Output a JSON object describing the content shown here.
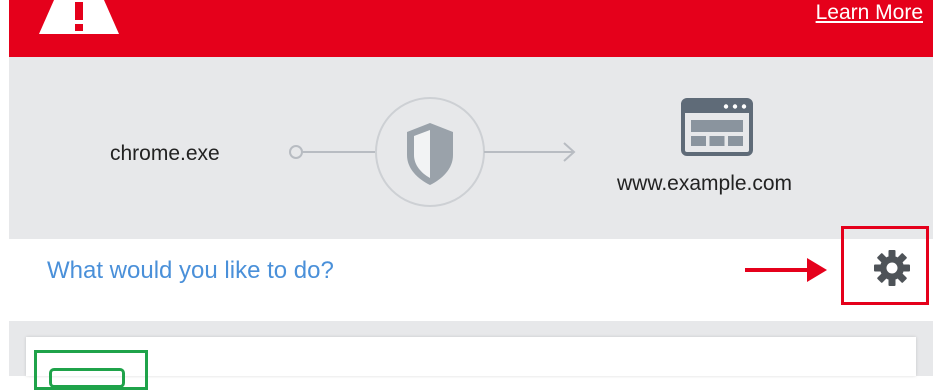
{
  "header": {
    "learn_more_label": "Learn More",
    "icon": "warning-icon",
    "color": "#e5001b"
  },
  "flow": {
    "process_name": "chrome.exe",
    "destination": "www.example.com",
    "shield_icon": "shield-icon",
    "site_icon": "browser-window-icon"
  },
  "prompt": {
    "question": "What would you like to do?",
    "settings_icon": "gear-icon",
    "annotation_icon": "red-arrow-icon"
  },
  "options": {
    "icon": "option-icon",
    "accent_color": "#1fa34a"
  }
}
